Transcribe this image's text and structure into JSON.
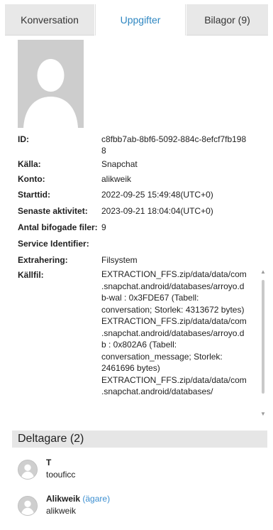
{
  "tabs": [
    {
      "label": "Konversation"
    },
    {
      "label": "Uppgifter"
    },
    {
      "label": "Bilagor (9)"
    }
  ],
  "details": {
    "id_label": "ID:",
    "id_value": "c8fbb7ab-8bf6-5092-884c-8efcf7fb1988",
    "source_label": "Källa:",
    "source_value": "Snapchat",
    "account_label": "Konto:",
    "account_value": "alikweik",
    "start_label": "Starttid:",
    "start_value": "2022-09-25 15:49:48(UTC+0)",
    "last_label": "Senaste aktivitet:",
    "last_value": "2023-09-21 18:04:04(UTC+0)",
    "attachments_label": "Antal bifogade filer:",
    "attachments_value": "9",
    "service_label": "Service Identifier:",
    "service_value": "",
    "extraction_label": "Extrahering:",
    "extraction_value": "Filsystem",
    "sourcefile_label": "Källfil:",
    "sourcefile_value": "EXTRACTION_FFS.zip/data/data/com.snapchat.android/databases/arroyo.db-wal : 0x3FDE67 (Tabell: conversation; Storlek: 4313672 bytes) EXTRACTION_FFS.zip/data/data/com.snapchat.android/databases/arroyo.db : 0x802A6 (Tabell: conversation_message; Storlek: 2461696 bytes) EXTRACTION_FFS.zip/data/data/com.snapchat.android/databases/"
  },
  "participants": {
    "header": "Deltagare (2)",
    "items": [
      {
        "name": "T",
        "role": "",
        "username": "toouficc"
      },
      {
        "name": "Alikweik",
        "role": "(ägare)",
        "username": "alikweik"
      }
    ]
  },
  "colors": {
    "accent": "#2e86c1",
    "owner_tag": "#3b8ed0",
    "header_bg": "#e6e6e6",
    "tab_inactive_bg": "#e8e8e8"
  },
  "icons": [
    "avatar-placeholder-icon",
    "scroll-up-icon",
    "scroll-down-icon"
  ]
}
